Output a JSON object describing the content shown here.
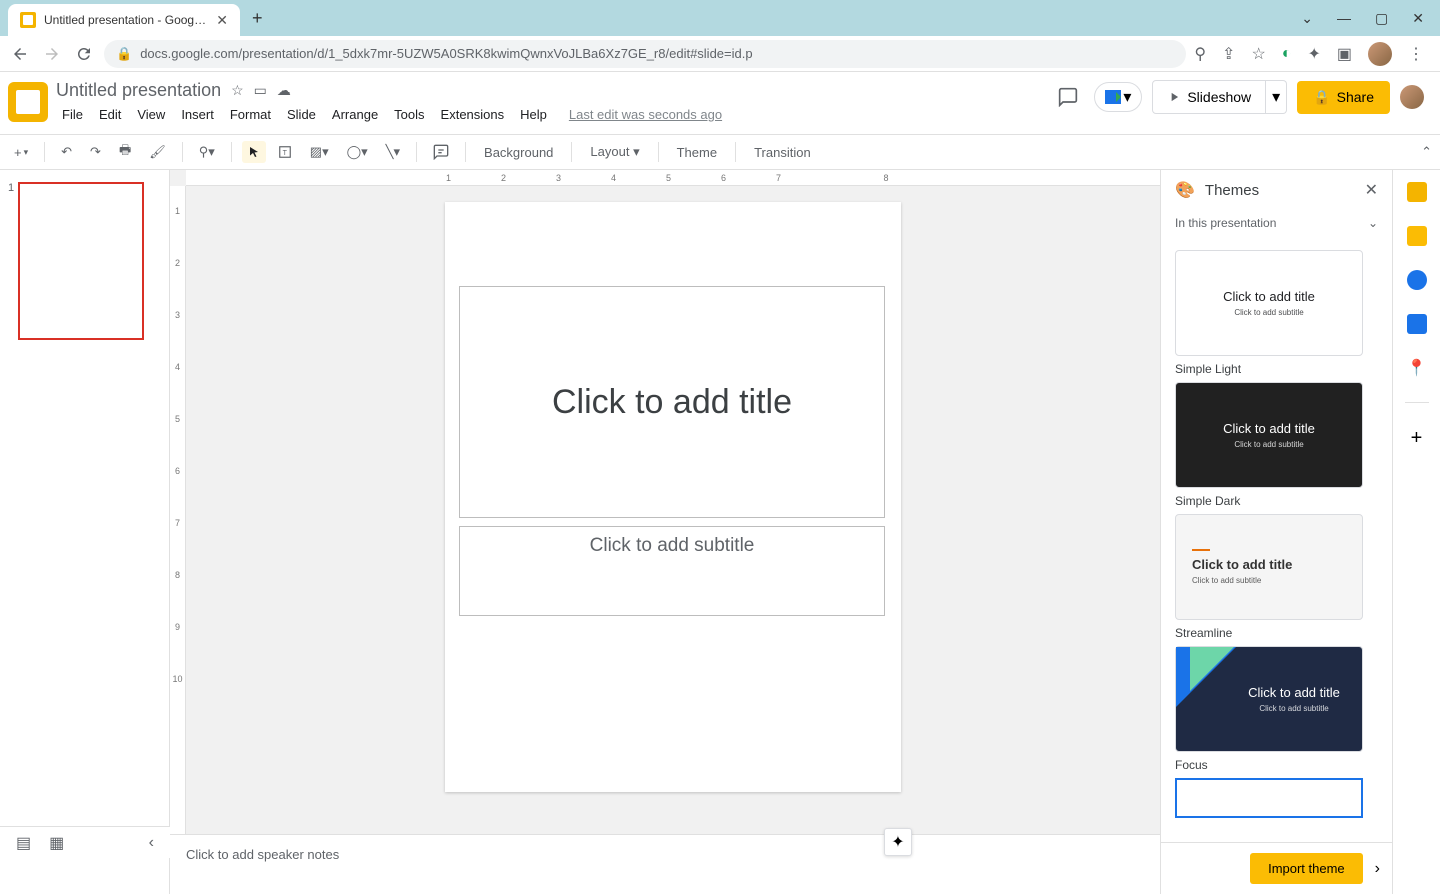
{
  "browser": {
    "tab_title": "Untitled presentation - Google Sl",
    "url": "docs.google.com/presentation/d/1_5dxk7mr-5UZW5A0SRK8kwimQwnxVoJLBa6Xz7GE_r8/edit#slide=id.p"
  },
  "doc": {
    "title": "Untitled presentation",
    "last_edit": "Last edit was seconds ago"
  },
  "menu": {
    "file": "File",
    "edit": "Edit",
    "view": "View",
    "insert": "Insert",
    "format": "Format",
    "slide": "Slide",
    "arrange": "Arrange",
    "tools": "Tools",
    "extensions": "Extensions",
    "help": "Help"
  },
  "header": {
    "slideshow": "Slideshow",
    "share": "Share"
  },
  "toolbar": {
    "background": "Background",
    "layout": "Layout",
    "theme": "Theme",
    "transition": "Transition"
  },
  "slide": {
    "title_placeholder": "Click to add title",
    "subtitle_placeholder": "Click to add subtitle"
  },
  "notes": {
    "placeholder": "Click to add speaker notes"
  },
  "themes": {
    "title": "Themes",
    "section": "In this presentation",
    "card_title": "Click to add title",
    "card_sub": "Click to add subtitle",
    "names": {
      "light": "Simple Light",
      "dark": "Simple Dark",
      "stream": "Streamline",
      "focus": "Focus"
    },
    "import": "Import theme"
  },
  "ruler": {
    "h": "1234567 8",
    "v": [
      "1",
      "2",
      "3",
      "4",
      "5",
      "6",
      "7",
      "8",
      "9",
      "10"
    ]
  }
}
